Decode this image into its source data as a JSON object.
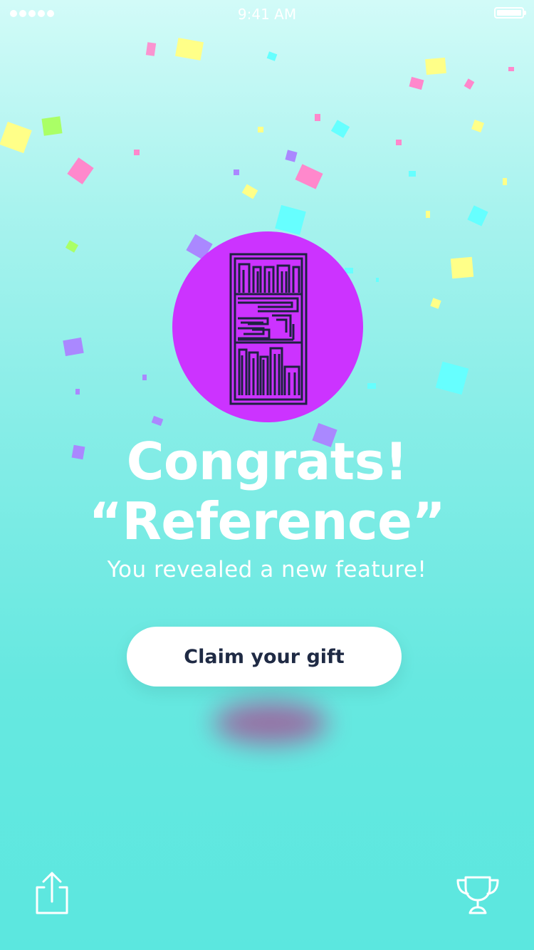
{
  "status_bar": {
    "time": "9:41 AM",
    "signal_icon": "signal-dots-icon",
    "battery_icon": "battery-icon"
  },
  "badge": {
    "icon": "bookshelf-maze-icon",
    "color": "#cc33ff"
  },
  "headline": {
    "line1": "Congrats!",
    "line2": "“Reference”"
  },
  "subtitle": "You revealed a new feature!",
  "claim_button": {
    "label": "Claim your gift",
    "text_color": "#1f2a44"
  },
  "bottom_bar": {
    "share_icon": "share-icon",
    "trophy_icon": "trophy-icon"
  },
  "colors": {
    "background_top": "#d2fbf8",
    "background_bottom": "#5be7df",
    "confetti": [
      "#ffff88",
      "#ff88cc",
      "#66ffff",
      "#aa88ff",
      "#aaff66"
    ]
  }
}
